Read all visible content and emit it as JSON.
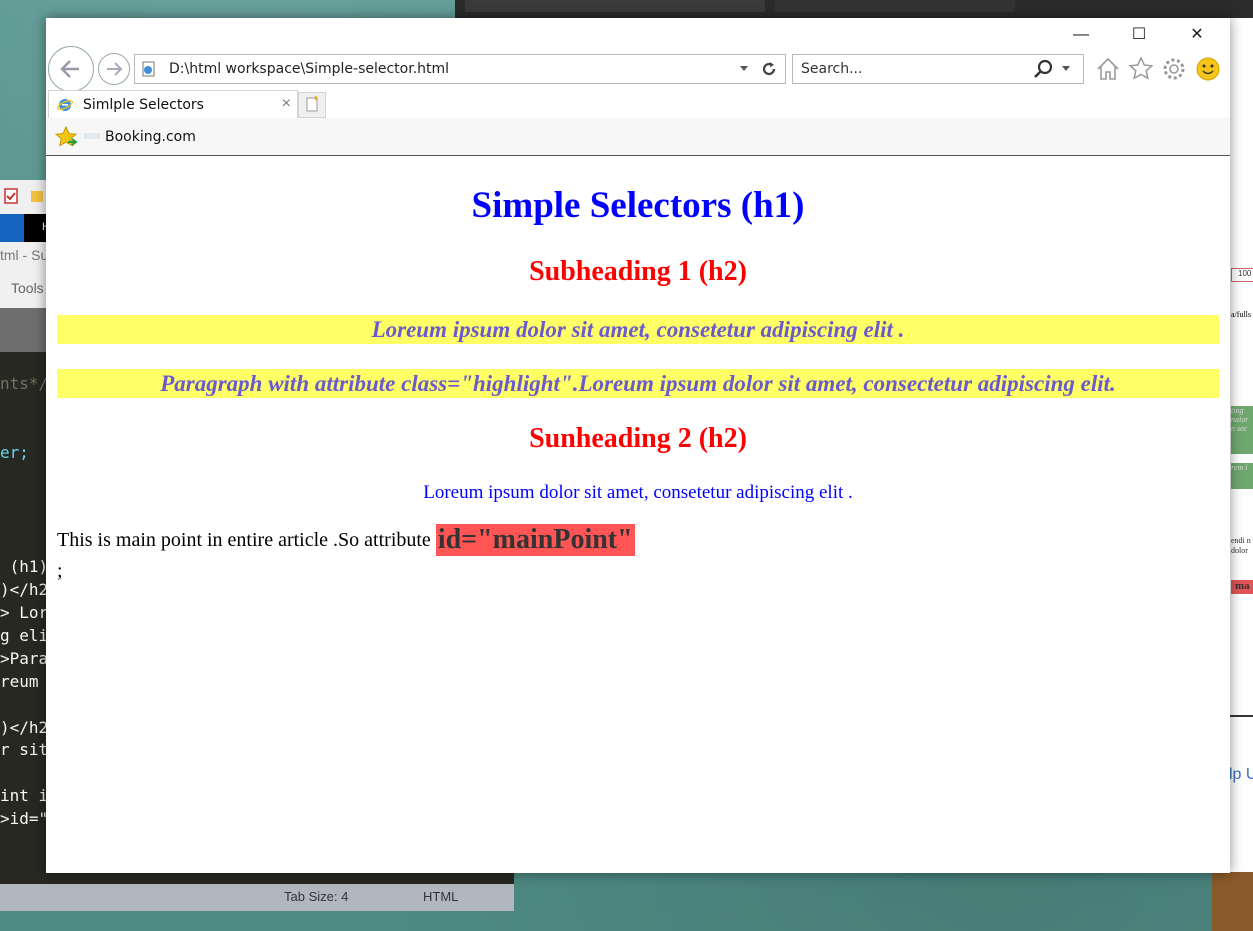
{
  "sublime": {
    "title_fragment": "tml - Su",
    "menu_tools": "Tools",
    "tab_fragment": "H",
    "code_lines": [
      "nts*/",
      "",
      "",
      "er;",
      "",
      "",
      "",
      "",
      " (h1)",
      ")</h2",
      "> Lor",
      "g eli",
      ">Para",
      "reum ",
      "",
      ")</h2",
      "r sit",
      "",
      "int i",
      ">id=\"mainPoint\"</span>"
    ],
    "status_tab_size": "Tab Size: 4",
    "status_syntax": "HTML"
  },
  "right_pane": {
    "zoom": "100",
    "path_fragment": "a/fulls",
    "text_fragments": [
      "ting",
      "naior",
      "n sec",
      "rem i",
      "endi n",
      "dolor",
      "ma"
    ],
    "link_fragment": "lp U"
  },
  "browser": {
    "window_buttons": {
      "minimize": "—",
      "maximize": "☐",
      "close": "✕"
    },
    "address": "D:\\html workspace\\Simple-selector.html",
    "search_placeholder": "Search...",
    "tab_title": "Simlple Selectors",
    "favorites": {
      "item": "Booking.com"
    },
    "icons": {
      "back": "back-arrow-icon",
      "forward": "forward-arrow-icon",
      "refresh": "refresh-icon",
      "search": "magnifier-icon",
      "home": "home-icon",
      "favorites": "star-icon",
      "settings": "gear-icon",
      "feedback": "smiley-icon"
    }
  },
  "page": {
    "h1": "Simple Selectors (h1)",
    "subheading1": "Subheading 1 (h2)",
    "highlight1": "Loreum ipsum dolor sit amet, consetetur adipiscing elit .",
    "highlight2": "Paragraph with attribute class=\"highlight\".Loreum ipsum dolor sit amet, consectetur adipiscing elit.",
    "subheading2": "Sunheading 2 (h2)",
    "paragraph": "Loreum ipsum dolor sit amet, consetetur adipiscing elit .",
    "main_text": "This is main point in entire article .So attribute ",
    "main_point": "id=\"mainPoint\"",
    "trailing": ";"
  },
  "colors": {
    "h1": "#0000ff",
    "h2": "#ff0000",
    "highlight_bg": "#ffff66",
    "highlight_text": "#6a5acd",
    "mainpoint_bg": "#ff5555"
  }
}
